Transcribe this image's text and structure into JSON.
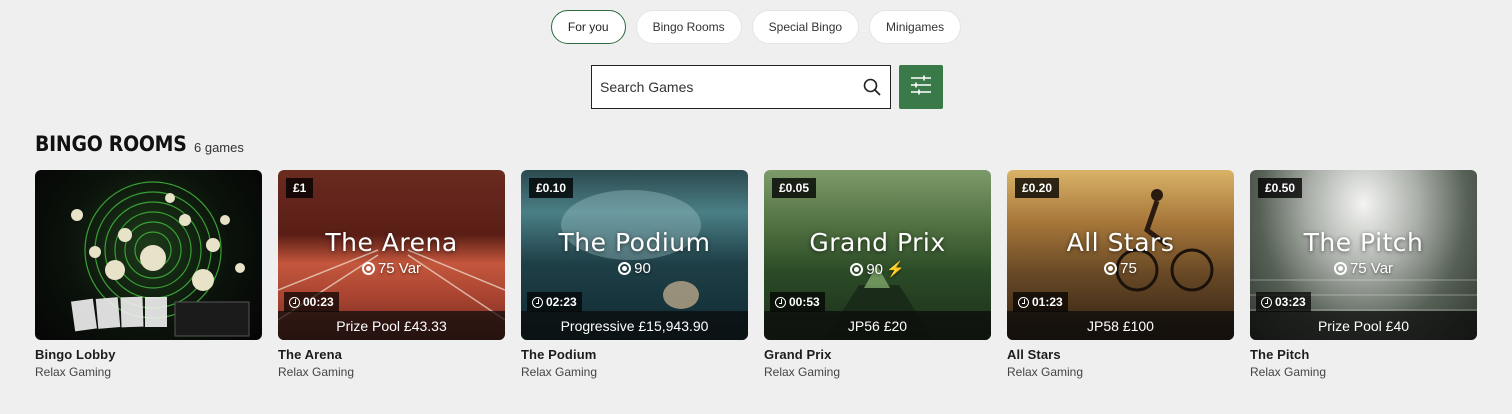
{
  "tabs": [
    {
      "label": "For you",
      "active": true
    },
    {
      "label": "Bingo Rooms",
      "active": false
    },
    {
      "label": "Special Bingo",
      "active": false
    },
    {
      "label": "Minigames",
      "active": false
    }
  ],
  "search": {
    "placeholder": "Search Games",
    "value": ""
  },
  "section": {
    "title": "BINGO ROOMS",
    "count": "6 games"
  },
  "colors": {
    "accent": "#3a7a48",
    "active_border": "#2f6b3d",
    "background": "#efefef"
  },
  "icons": {
    "search": "search-icon",
    "filter": "sliders-icon",
    "balls": "ball-icon",
    "timer": "clock-icon"
  },
  "games": [
    {
      "name": "Bingo Lobby",
      "provider": "Relax Gaming",
      "stake": "",
      "title": "",
      "balls": "",
      "timer": "",
      "jackpot": ""
    },
    {
      "name": "The Arena",
      "provider": "Relax Gaming",
      "stake": "£1",
      "title": "The Arena",
      "balls": "75 Var",
      "timer": "00:23",
      "jackpot": "Prize Pool £43.33"
    },
    {
      "name": "The Podium",
      "provider": "Relax Gaming",
      "stake": "£0.10",
      "title": "The Podium",
      "balls": "90",
      "timer": "02:23",
      "jackpot": "Progressive £15,943.90"
    },
    {
      "name": "Grand Prix",
      "provider": "Relax Gaming",
      "stake": "£0.05",
      "title": "Grand Prix",
      "balls": "90",
      "timer": "00:53",
      "jackpot": "JP56 £20"
    },
    {
      "name": "All Stars",
      "provider": "Relax Gaming",
      "stake": "£0.20",
      "title": "All Stars",
      "balls": "75",
      "timer": "01:23",
      "jackpot": "JP58 £100"
    },
    {
      "name": "The Pitch",
      "provider": "Relax Gaming",
      "stake": "£0.50",
      "title": "The Pitch",
      "balls": "75 Var",
      "timer": "03:23",
      "jackpot": "Prize Pool £40"
    }
  ]
}
